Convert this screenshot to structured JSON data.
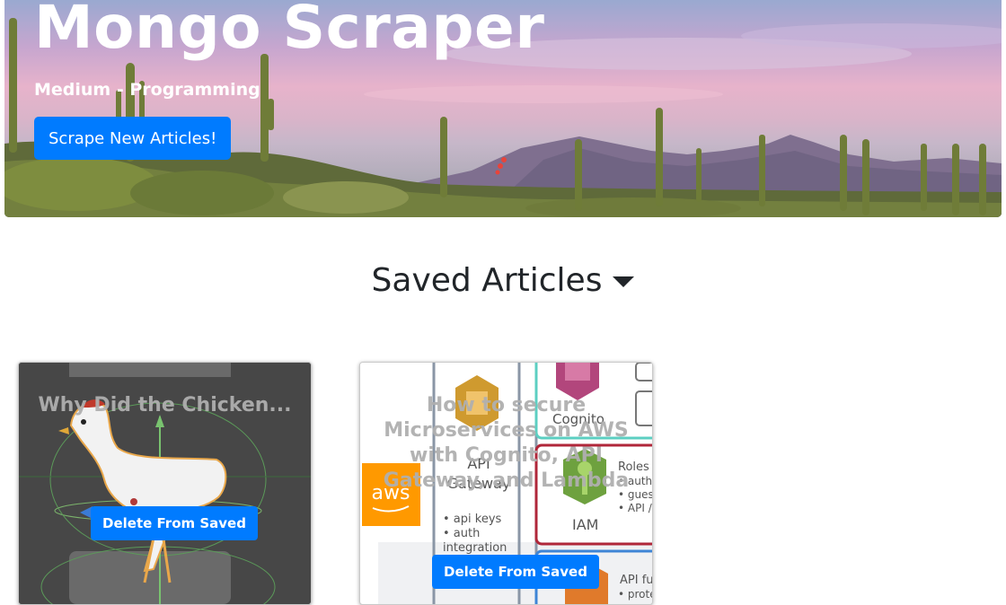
{
  "hero": {
    "title": "Mongo Scraper",
    "subtitle": "Medium - Programming",
    "scrape_button": "Scrape New Articles!"
  },
  "saved": {
    "heading": "Saved Articles"
  },
  "articles": [
    {
      "title": "Why Did the Chicken...",
      "delete_button": "Delete From Saved"
    },
    {
      "title": "How to secure Microservices on AWS with Cognito, API Gateway, and Lambda",
      "delete_button": "Delete From Saved"
    }
  ],
  "aws_diagram": {
    "logo": "aws",
    "labels": {
      "cognito": "Cognito",
      "api": "API",
      "gateway": "Gateway",
      "api_keys": "• api keys",
      "auth": "• auth",
      "integration": "integration",
      "iam": "IAM",
      "roles": "Roles",
      "authe": "• authe",
      "gues": "• gues",
      "api_slash": "• API /",
      "api_fu": "API fu",
      "prote": "• prote"
    }
  },
  "colors": {
    "primary": "#007bff",
    "hero_text": "#ffffff",
    "aws_orange": "#ff9900"
  }
}
